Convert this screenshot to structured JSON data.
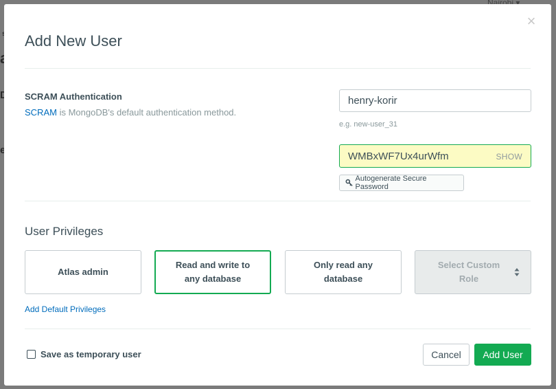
{
  "background": {
    "region_text": "Nairobi ▾",
    "fragment_a": "a",
    "fragment_d": "D",
    "fragment_e": "e",
    "fragment_dot": "s"
  },
  "modal": {
    "title": "Add New User",
    "close_glyph": "×"
  },
  "auth": {
    "title": "SCRAM Authentication",
    "link_text": "SCRAM",
    "description_rest": " is MongoDB's default authentication method.",
    "username_value": "henry-korir",
    "username_hint": "e.g. new-user_31",
    "password_value": "WMBxWF7Ux4urWfm",
    "show_label": "SHOW",
    "autogenerate_label": "Autogenerate Secure Password"
  },
  "privileges": {
    "title": "User Privileges",
    "options": [
      {
        "label": "Atlas admin",
        "selected": false
      },
      {
        "label": "Read and write to any database",
        "selected": true
      },
      {
        "label": "Only read any database",
        "selected": false
      }
    ],
    "custom_select_label": "Select Custom Role",
    "add_default_link": "Add Default Privileges"
  },
  "footer": {
    "temporary_label": "Save as temporary user",
    "temporary_checked": false,
    "cancel_label": "Cancel",
    "add_label": "Add User"
  },
  "colors": {
    "accent_green": "#13aa52",
    "link_blue": "#006cbc",
    "password_highlight": "#fcfbc4"
  },
  "icons": {
    "close": "close-icon",
    "key": "key-icon",
    "select_arrows": "up-down-arrows-icon"
  }
}
